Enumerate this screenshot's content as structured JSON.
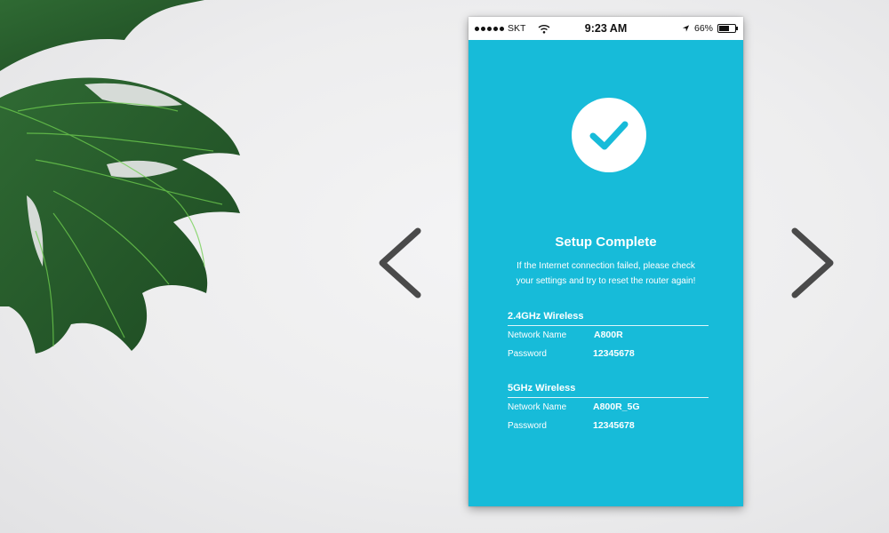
{
  "status_bar": {
    "carrier": "SKT",
    "time": "9:23 AM",
    "battery_percent": "66%",
    "battery_level": 0.66,
    "icons": [
      "signal-dots-icon",
      "wifi-icon",
      "location-arrow-icon",
      "battery-icon"
    ]
  },
  "colors": {
    "screen_background": "#17bbd9",
    "check_circle": "#ffffff",
    "check_mark": "#17bbd9",
    "arrow": "#4a4a4a"
  },
  "navigation": {
    "prev_icon": "chevron-left-icon",
    "next_icon": "chevron-right-icon"
  },
  "setup": {
    "status_icon": "checkmark-icon",
    "title": "Setup Complete",
    "subtitle_line1": "If the Internet connection failed, please check",
    "subtitle_line2": "your settings and try to reset the router again!"
  },
  "networks": [
    {
      "band_title": "2.4GHz Wireless",
      "name_label": "Network Name",
      "name_value": "A800R",
      "password_label": "Password",
      "password_value": "12345678"
    },
    {
      "band_title": "5GHz Wireless",
      "name_label": "Network Name",
      "name_value": "A800R_5G",
      "password_label": "Password",
      "password_value": "12345678"
    }
  ]
}
